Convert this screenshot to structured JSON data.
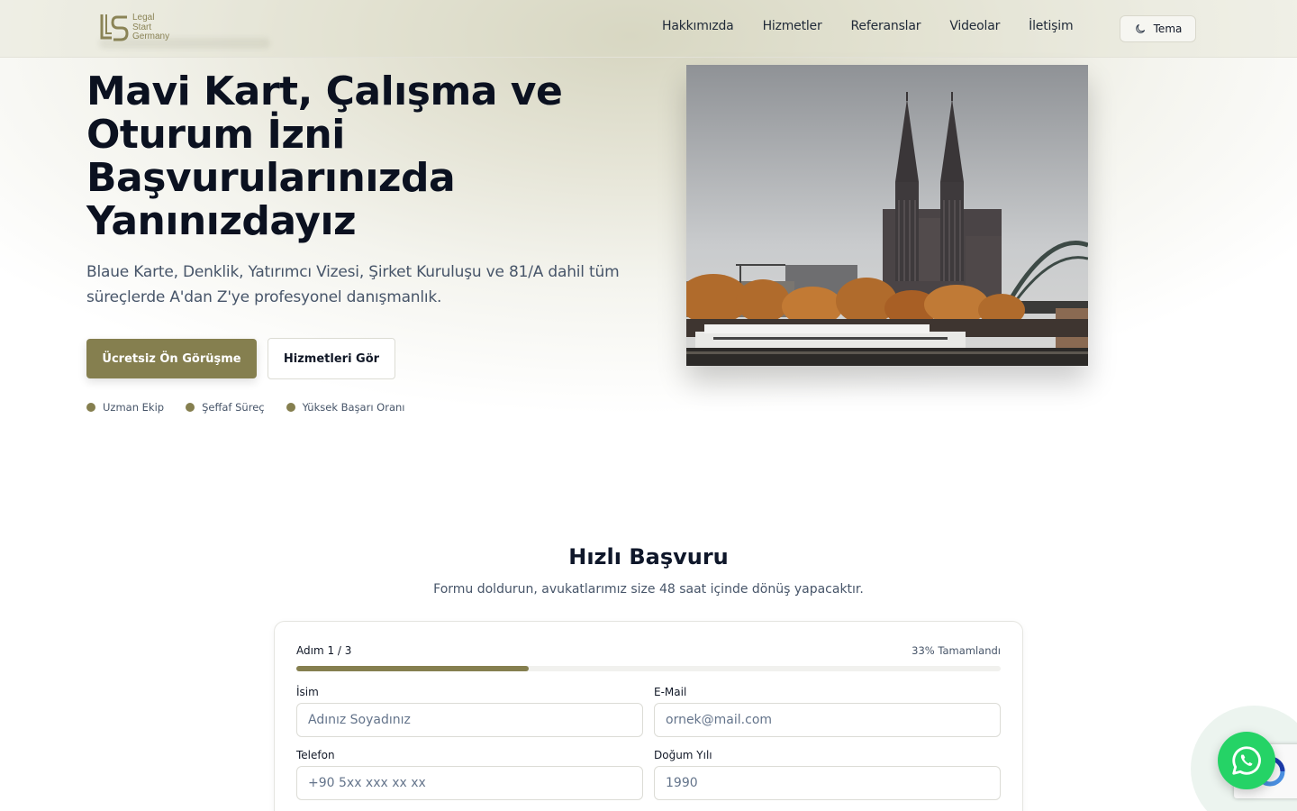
{
  "brand": {
    "name_lines": [
      "Legal",
      "Start",
      "Germany"
    ],
    "accent": "#857f4f"
  },
  "nav": {
    "links": [
      "Hakkımızda",
      "Hizmetler",
      "Referanslar",
      "Videolar",
      "İletişim"
    ],
    "theme_label": "Tema",
    "theme_icon": "moon-icon"
  },
  "hero": {
    "title": "Mavi Kart, Çalışma ve Oturum İzni Başvurularınızda Yanınızdayız",
    "subtitle": "Blaue Karte, Denklik, Yatırımcı Vizesi, Şirket Kuruluşu ve 81/A dahil tüm süreçlerde A'dan Z'ye profesyonel danışmanlık.",
    "primary_cta": "Ücretsiz Ön Görüşme",
    "secondary_cta": "Hizmetleri Gör",
    "badges": [
      "Uzman Ekip",
      "Şeffaf Süreç",
      "Yüksek Başarı Oranı"
    ],
    "image": "cologne-cathedral-photo"
  },
  "form": {
    "title": "Hızlı Başvuru",
    "subtitle": "Formu doldurun, avukatlarımız size 48 saat içinde dönüş yapacaktır.",
    "step": "Adım 1 / 3",
    "percent_label": "33% Tamamlandı",
    "progress": 0.33,
    "fields": {
      "name": {
        "label": "İsim",
        "placeholder": "Adınız Soyadınız"
      },
      "email": {
        "label": "E-Mail",
        "placeholder": "ornek@mail.com"
      },
      "phone": {
        "label": "Telefon",
        "placeholder": "+90 5xx xxx xx xx"
      },
      "birth_year": {
        "label": "Doğum Yılı",
        "placeholder": "1990"
      }
    }
  },
  "whatsapp": {
    "icon": "whatsapp-icon",
    "color": "#25d366"
  }
}
